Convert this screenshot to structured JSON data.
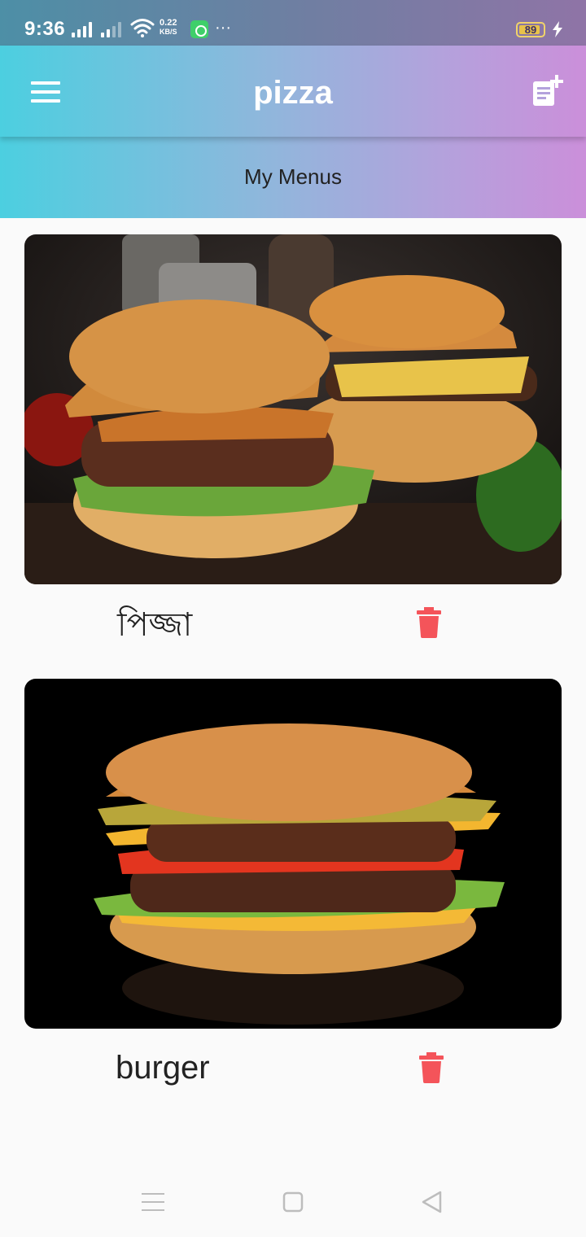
{
  "status_bar": {
    "time": "9:36",
    "speed_value": "0.22",
    "speed_unit": "KB/S",
    "battery": "89",
    "battery_level": 0.89
  },
  "app_bar": {
    "title": "pizza",
    "menu_icon": "hamburger-menu-icon",
    "action_icon": "note-add-icon"
  },
  "subheader": {
    "title": "My Menus"
  },
  "menus": [
    {
      "name": "পিজ্জা",
      "image": "burger-pair-photo",
      "action_icon": "trash-icon"
    },
    {
      "name": "burger",
      "image": "burger-single-photo",
      "action_icon": "trash-icon"
    }
  ],
  "nav_bar": {
    "icons": [
      "menu-lines-icon",
      "home-square-icon",
      "back-triangle-icon"
    ]
  },
  "colors": {
    "accent_cyan": "#4ccfe0",
    "accent_violet": "#cb8fda",
    "delete_red": "#f4545a"
  }
}
